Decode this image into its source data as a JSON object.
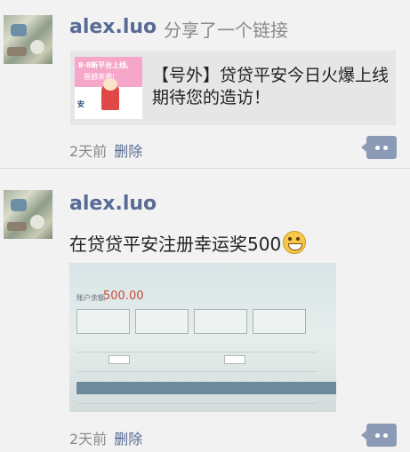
{
  "posts": [
    {
      "author": "alex.luo",
      "action": "分享了一个链接",
      "link": {
        "title": "【号外】贷贷平安今日火爆上线  期待您的造访！",
        "thumb_text_1": "8·8新平台上线,",
        "thumb_text_2": "震撼来袭!",
        "thumb_text_3": "安"
      },
      "time": "2天前",
      "delete_label": "删除",
      "comment_icon": "comment-ellipsis-icon"
    },
    {
      "author": "alex.luo",
      "text": "在贷贷平安注册幸运奖500",
      "emoji": "grinning-face-icon",
      "photo": {
        "balance_label": "账户余额",
        "balance_value": "500.00"
      },
      "time": "2天前",
      "delete_label": "删除",
      "comment_icon": "comment-ellipsis-icon"
    }
  ],
  "colors": {
    "name": "#576b95",
    "background": "#f2f2f2",
    "comment_button": "#8b9bb5"
  }
}
